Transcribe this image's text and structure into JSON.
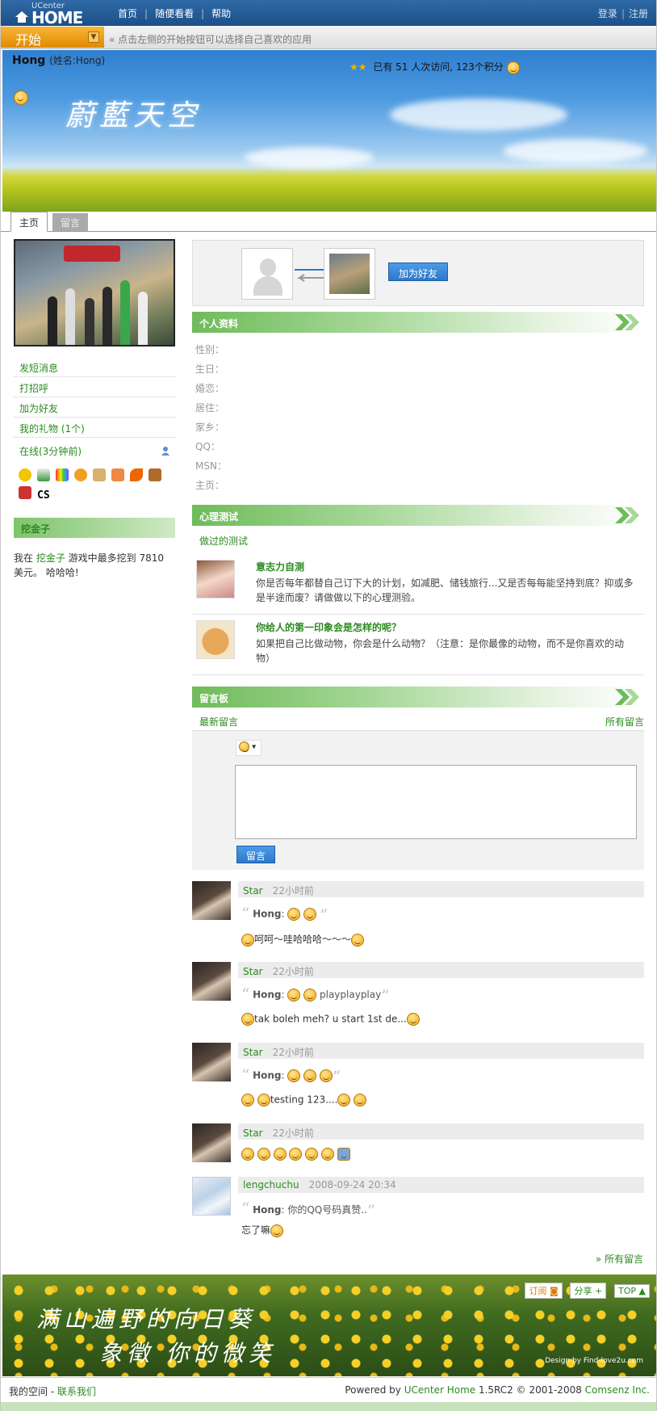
{
  "topbar": {
    "logo_top": "UCenter",
    "logo_main": "HOME",
    "nav": [
      "首页",
      "随便看看",
      "帮助"
    ],
    "login": "登录",
    "register": "注册"
  },
  "startbar": {
    "start_label": "开始",
    "hint": "« 点击左侧的开始按钮可以选择自己喜欢的应用"
  },
  "banner": {
    "username": "Hong",
    "realname": "(姓名:Hong)",
    "visits": "已有 51 人次访问, 123个积分",
    "title_art": "蔚藍天空"
  },
  "tabs": [
    "主页",
    "留言"
  ],
  "left": {
    "menu": [
      "发短消息",
      "打招呼",
      "加为好友",
      "我的礼物 (1个)"
    ],
    "online": "在线(3分钟前)",
    "app_cs": "CS",
    "game_head": "挖金子",
    "game_pre": "我在 ",
    "game_link": "挖金子",
    "game_post": " 游戏中最多挖到 7810 美元。 哈哈哈!"
  },
  "friendbox": {
    "add_friend": "加为好友"
  },
  "profile": {
    "head": "个人资料",
    "fields": [
      "性别：",
      "生日：",
      "婚恋：",
      "居住：",
      "家乡：",
      "QQ：",
      "MSN：",
      "主页："
    ]
  },
  "psych": {
    "head": "心理测试",
    "done": "做过的测试",
    "tests": [
      {
        "title": "意志力自测",
        "desc": "你是否每年都替自己订下大的计划，如减肥、储钱旅行...又是否每每能坚持到底？抑或多是半途而废？请做做以下的心理测验。"
      },
      {
        "title": "你给人的第一印象会是怎样的呢？",
        "desc": "如果把自己比做动物，你会是什么动物？（注意：是你最像的动物，而不是你喜欢的动物）"
      }
    ]
  },
  "board": {
    "head": "留言板",
    "latest": "最新留言",
    "all": "所有留言",
    "post_button": "留言",
    "all_bottom": "» 所有留言"
  },
  "comments": [
    {
      "who": "Star",
      "when": "22小时前",
      "quote_user": "Hong",
      "quote_text": "",
      "body": "呵呵～哇哈哈哈～～～"
    },
    {
      "who": "Star",
      "when": "22小时前",
      "quote_user": "Hong",
      "quote_text": "playplayplay",
      "body": "tak boleh meh? u start 1st de..."
    },
    {
      "who": "Star",
      "when": "22小时前",
      "quote_user": "Hong",
      "quote_text": "",
      "body": "testing 123...."
    },
    {
      "who": "Star",
      "when": "22小时前",
      "quote_user": "",
      "quote_text": "",
      "body": ""
    },
    {
      "who": "lengchuchu",
      "when": "2008-09-24 20:34",
      "quote_user": "Hong",
      "quote_text": "你的QQ号码真赞..",
      "body": "忘了嘛"
    }
  ],
  "footer_banner": {
    "line1": "满山遍野的向日葵",
    "line2": "象徵 你的微笑",
    "design": "Design by Find-love2u.com",
    "rss": "订阅",
    "share": "分享",
    "top": "TOP"
  },
  "footer": {
    "my_space": "我的空间",
    "contact": "联系我们",
    "powered_pre": "Powered by ",
    "product": "UCenter Home",
    "version": " 1.5RC2 © 2001-2008 ",
    "company": "Comsenz Inc."
  },
  "colors": {
    "link": "#2b8a1f",
    "topbar": "#2f6aa8",
    "start": "#f3a21a",
    "button": "#2f78c8"
  }
}
